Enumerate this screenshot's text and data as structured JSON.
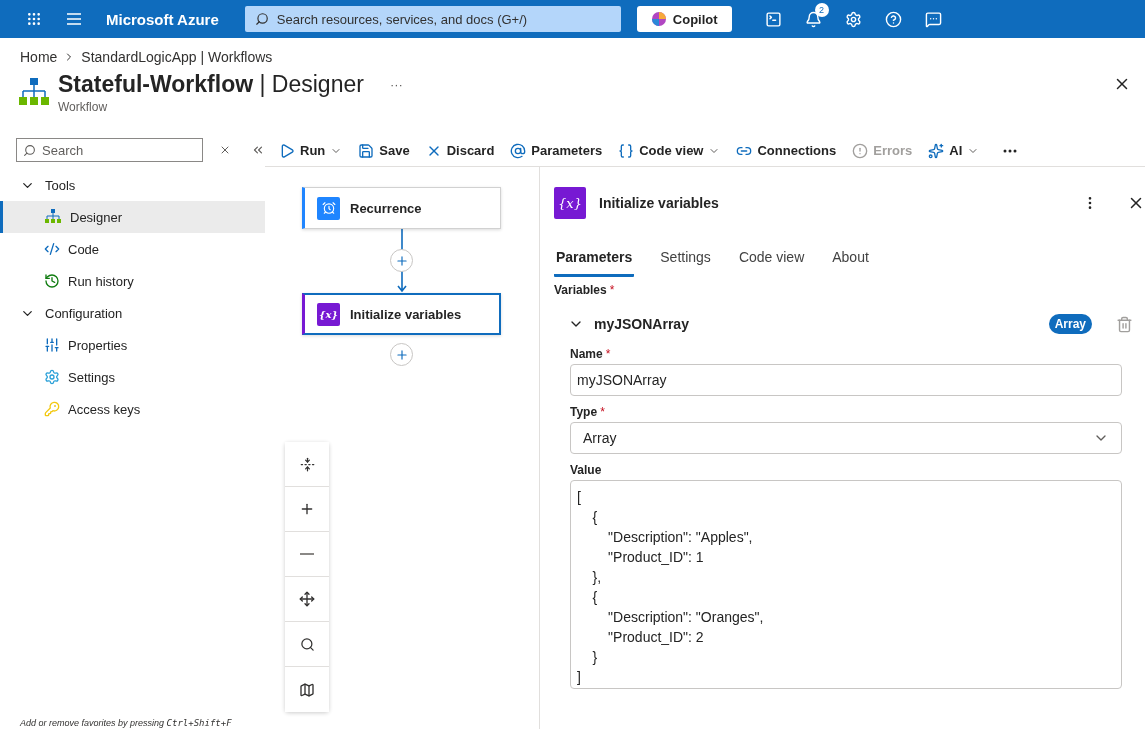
{
  "topbar": {
    "brand": "Microsoft Azure",
    "search_placeholder": "Search resources, services, and docs (G+/)",
    "copilot": "Copilot",
    "notification_count": "2"
  },
  "breadcrumb": [
    "Home",
    "StandardLogicApp | Workflows"
  ],
  "page": {
    "title": "**Stateful-Workflow** | Designer",
    "subtitle": "Workflow",
    "more": "···"
  },
  "sidebar": {
    "search_placeholder": "Search",
    "groups": [
      {
        "label": "Tools",
        "expanded": true,
        "children": [
          {
            "label": "Designer",
            "selected": true
          },
          {
            "label": "Code",
            "selected": false
          },
          {
            "label": "Run history",
            "selected": false
          }
        ]
      },
      {
        "label": "Configuration",
        "expanded": true,
        "children": [
          {
            "label": "Properties",
            "selected": false
          },
          {
            "label": "Settings",
            "selected": false
          },
          {
            "label": "Access keys",
            "selected": false
          }
        ]
      }
    ],
    "footer": "Add or remove favorites by pressing ",
    "shortcut": "Ctrl+Shift+F"
  },
  "toolbar": [
    {
      "label": "Run",
      "dropdown": true,
      "disabled": false
    },
    {
      "label": "Save",
      "dropdown": false,
      "disabled": false
    },
    {
      "label": "Discard",
      "dropdown": false,
      "disabled": false
    },
    {
      "label": "Parameters",
      "dropdown": false,
      "disabled": false
    },
    {
      "label": "Code view",
      "dropdown": true,
      "disabled": false
    },
    {
      "label": "Connections",
      "dropdown": false,
      "disabled": false
    },
    {
      "label": "Errors",
      "dropdown": false,
      "disabled": true
    },
    {
      "label": "AI",
      "dropdown": true,
      "disabled": false
    }
  ],
  "canvas": {
    "nodes": [
      {
        "label": "Recurrence",
        "kind": "trigger",
        "selected": false
      },
      {
        "label": "Initialize variables",
        "kind": "variable",
        "icon_text": "{x}",
        "selected": true
      }
    ]
  },
  "panel": {
    "icon_text": "{x}",
    "title": "Initialize variables",
    "tabs": [
      {
        "label": "Parameters",
        "selected": true
      },
      {
        "label": "Settings",
        "selected": false
      },
      {
        "label": "Code view",
        "selected": false
      },
      {
        "label": "About",
        "selected": false
      }
    ],
    "required_mark": "*",
    "variables_label": "Variables",
    "variables_required": true,
    "variable": {
      "name": "myJSONArray",
      "expanded": true,
      "badge": "Array",
      "fields": [
        {
          "kind": "text",
          "label": "Name",
          "required": true,
          "value": "myJSONArray"
        },
        {
          "kind": "select",
          "label": "Type",
          "required": true,
          "value": "Array"
        },
        {
          "kind": "multiline",
          "label": "Value",
          "required": false,
          "value": "[\n    {\n        \"Description\": \"Apples\",\n        \"Product_ID\": 1\n    },\n    {\n        \"Description\": \"Oranges\",\n        \"Product_ID\": 2\n    }\n]"
        }
      ]
    }
  }
}
